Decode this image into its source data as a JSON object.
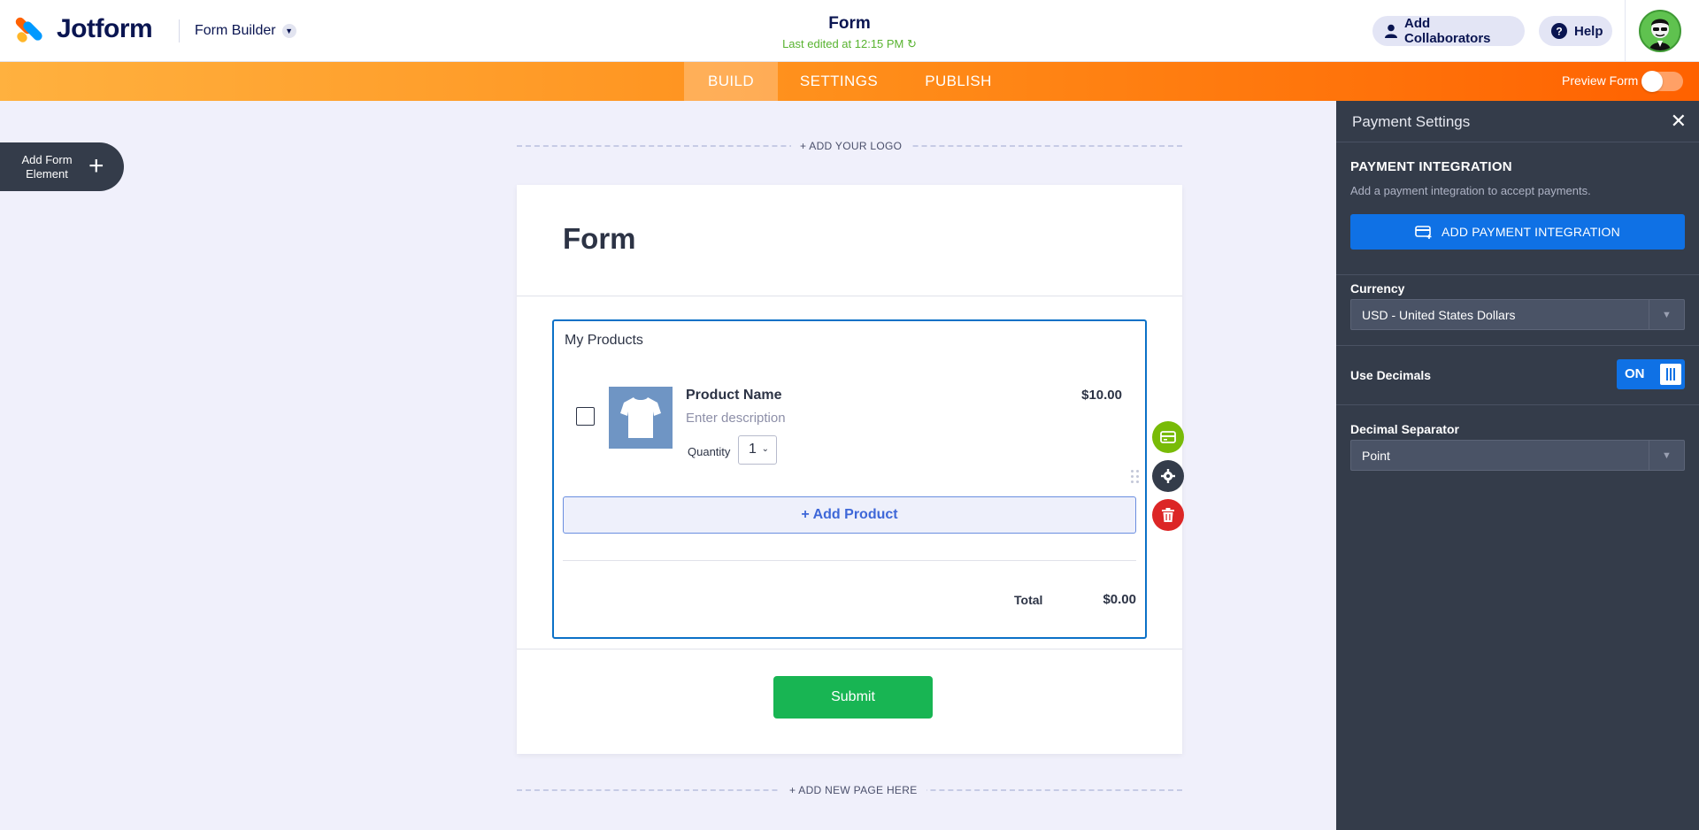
{
  "header": {
    "logo_text": "Jotform",
    "builder_label": "Form Builder",
    "form_title": "Form",
    "last_edited": "Last edited at 12:15 PM",
    "add_collaborators": "Add Collaborators",
    "help": "Help"
  },
  "tabs": [
    {
      "label": "BUILD",
      "active": true
    },
    {
      "label": "SETTINGS",
      "active": false
    },
    {
      "label": "PUBLISH",
      "active": false
    }
  ],
  "preview_form": {
    "label": "Preview Form",
    "on": false
  },
  "add_element": {
    "label": "Add Form Element"
  },
  "canvas": {
    "add_logo": "+ ADD YOUR LOGO",
    "add_page": "+ ADD NEW PAGE HERE",
    "form_heading": "Form",
    "products": {
      "label": "My Products",
      "items": [
        {
          "name": "Product Name",
          "description": "Enter description",
          "price": "$10.00",
          "quantity_label": "Quantity",
          "quantity": "1"
        }
      ],
      "add_product": "+ Add Product",
      "total_label": "Total",
      "total_value": "$0.00"
    },
    "submit": "Submit"
  },
  "panel": {
    "title": "Payment Settings",
    "integration_title": "PAYMENT INTEGRATION",
    "integration_sub": "Add a payment integration to accept payments.",
    "integration_button": "ADD PAYMENT INTEGRATION",
    "currency_label": "Currency",
    "currency_value": "USD - United States Dollars",
    "decimals_label": "Use Decimals",
    "decimals_toggle": "ON",
    "separator_label": "Decimal Separator",
    "separator_value": "Point"
  },
  "colors": {
    "brand_orange": "#ff6100",
    "accent_blue": "#0f71e5",
    "submit_green": "#18b553",
    "panel_bg": "#343c4a"
  }
}
